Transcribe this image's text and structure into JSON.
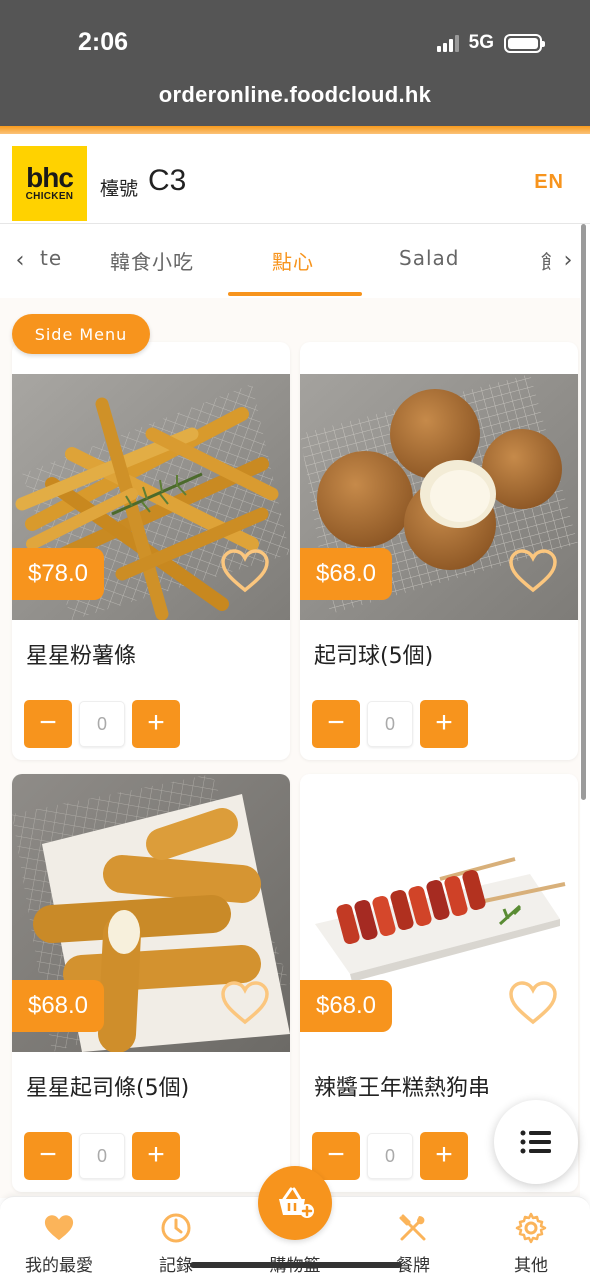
{
  "status_bar": {
    "time": "2:06",
    "network": "5G"
  },
  "browser": {
    "url": "orderonline.foodcloud.hk"
  },
  "header": {
    "logo_main": "bhc",
    "logo_sub": "CHICKEN",
    "table_label": "檯號",
    "table_number": "C3",
    "language_button": "EN"
  },
  "tabs": {
    "items": [
      {
        "label": "te"
      },
      {
        "label": "韓食小吃"
      },
      {
        "label": "點心",
        "active": true
      },
      {
        "label": "Salad"
      },
      {
        "label": "飠"
      }
    ]
  },
  "section": {
    "label": "Side Menu"
  },
  "products": [
    {
      "name": "星星粉薯條",
      "price": "$78.0",
      "quantity": "0",
      "image": "fries-photo"
    },
    {
      "name": "起司球(5個)",
      "price": "$68.0",
      "quantity": "0",
      "image": "cheese-balls-photo"
    },
    {
      "name": "星星起司條(5個)",
      "price": "$68.0",
      "quantity": "0",
      "image": "cheese-sticks-photo"
    },
    {
      "name": "辣醬王年糕熱狗串",
      "price": "$68.0",
      "quantity": "0",
      "image": "rice-cake-skewer-photo"
    }
  ],
  "controls": {
    "minus": "−",
    "plus": "+"
  },
  "bottom_nav": {
    "items": [
      {
        "label": "我的最愛",
        "icon": "heart-icon"
      },
      {
        "label": "記錄",
        "icon": "clock-icon"
      },
      {
        "label": "購物籃",
        "icon": "basket-icon"
      },
      {
        "label": "餐牌",
        "icon": "utensils-icon"
      },
      {
        "label": "其他",
        "icon": "gear-icon"
      }
    ]
  },
  "colors": {
    "accent": "#f7941d",
    "chrome": "#555555",
    "logo_yellow": "#ffd200"
  }
}
